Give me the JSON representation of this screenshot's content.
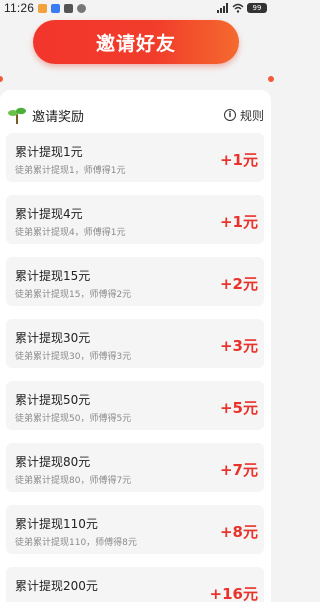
{
  "status_bar": {
    "time": "11:26",
    "battery": "99"
  },
  "invite_button": {
    "label": "邀请好友"
  },
  "section": {
    "title": "邀请奖励",
    "rules_label": "规则"
  },
  "rewards": [
    {
      "title": "累计提现1元",
      "desc": "徒弟累计提现1，师傅得1元",
      "amount": "+1元"
    },
    {
      "title": "累计提现4元",
      "desc": "徒弟累计提现4，师傅得1元",
      "amount": "+1元"
    },
    {
      "title": "累计提现15元",
      "desc": "徒弟累计提现15，师傅得2元",
      "amount": "+2元"
    },
    {
      "title": "累计提现30元",
      "desc": "徒弟累计提现30，师傅得3元",
      "amount": "+3元"
    },
    {
      "title": "累计提现50元",
      "desc": "徒弟累计提现50，师傅得5元",
      "amount": "+5元"
    },
    {
      "title": "累计提现80元",
      "desc": "徒弟累计提现80，师傅得7元",
      "amount": "+7元"
    },
    {
      "title": "累计提现110元",
      "desc": "徒弟累计提现110，师傅得8元",
      "amount": "+8元"
    },
    {
      "title": "累计提现200元",
      "desc": "",
      "amount": "+16元"
    }
  ],
  "colors": {
    "accent": "#f2352c",
    "amount": "#e8322a"
  }
}
